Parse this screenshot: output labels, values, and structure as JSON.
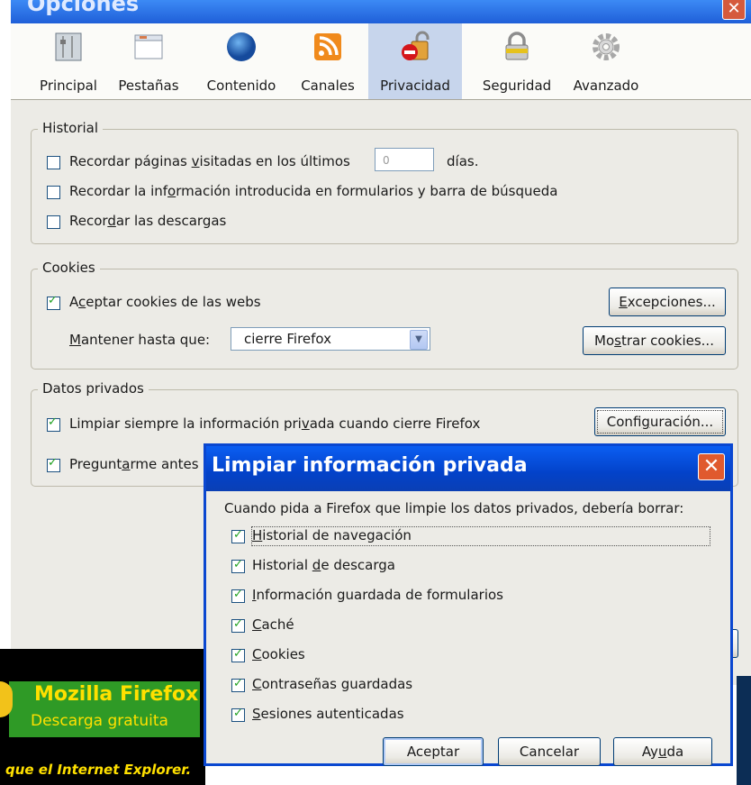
{
  "window": {
    "title": "Opciones"
  },
  "tabs": [
    {
      "label": "Principal",
      "icon": "switch-icon"
    },
    {
      "label": "Pestañas",
      "icon": "tabs-window-icon"
    },
    {
      "label": "Contenido",
      "icon": "globe-icon"
    },
    {
      "label": "Canales",
      "icon": "rss-feed-icon"
    },
    {
      "label": "Privacidad",
      "icon": "privacy-lock-icon",
      "selected": true
    },
    {
      "label": "Seguridad",
      "icon": "padlock-icon"
    },
    {
      "label": "Avanzado",
      "icon": "gear-icon"
    }
  ],
  "history": {
    "legend": "Historial",
    "remember_visited": {
      "label_a": "Recordar páginas ",
      "label_u": "v",
      "label_b": "isitadas en los últimos",
      "days_value": "0",
      "days_unit": "días.",
      "checked": false
    },
    "remember_forms": {
      "label_a": "Recordar la inf",
      "label_u": "o",
      "label_b": "rmación introducida en formularios y barra de búsqueda",
      "checked": false
    },
    "remember_downloads": {
      "label_a": "Recor",
      "label_u": "d",
      "label_b": "ar las descargas",
      "checked": false
    }
  },
  "cookies": {
    "legend": "Cookies",
    "accept": {
      "label_a": "A",
      "label_u": "c",
      "label_b": "eptar cookies de las webs",
      "checked": true
    },
    "keep_until_label_a": "",
    "keep_until_label_u": "M",
    "keep_until_label_b": "antener hasta que:",
    "keep_until_value": "cierre Firefox",
    "exceptions_button_a": "",
    "exceptions_button_u": "E",
    "exceptions_button_b": "xcepciones...",
    "show_cookies_button_a": "Mo",
    "show_cookies_button_u": "s",
    "show_cookies_button_b": "trar cookies..."
  },
  "private_data": {
    "legend": "Datos privados",
    "always_clear": {
      "label_a": "Limpiar siempre la información pri",
      "label_u": "v",
      "label_b": "ada cuando cierre Firefox",
      "checked": true
    },
    "ask_before": {
      "label_a": "Pregunt",
      "label_u": "a",
      "label_b": "rme antes",
      "checked": true
    },
    "settings_button_a": "Confi",
    "settings_button_u": "g",
    "settings_button_b": "uración..."
  },
  "ad": {
    "line1": "Mozilla Firefox",
    "line2": "Descarga gratuita",
    "line3": "que el Internet Explorer."
  },
  "dialog": {
    "title": "Limpiar información privada",
    "intro": "Cuando pida a Firefox que limpie los datos privados, debería borrar:",
    "items": [
      {
        "a": "",
        "u": "H",
        "b": "istorial de navegación",
        "checked": true
      },
      {
        "a": "Historial ",
        "u": "d",
        "b": "e descarga",
        "checked": true
      },
      {
        "a": "",
        "u": "I",
        "b": "nformación guardada de formularios",
        "checked": true
      },
      {
        "a": "",
        "u": "C",
        "b": "aché",
        "checked": true
      },
      {
        "a": "",
        "u": "C",
        "b": "ookies",
        "checked": true
      },
      {
        "a": "",
        "u": "C",
        "b": "ontraseñas guardadas",
        "checked": true
      },
      {
        "a": "",
        "u": "S",
        "b": "esiones autenticadas",
        "checked": true
      }
    ],
    "accept_button": "Aceptar",
    "cancel_button": "Cancelar",
    "help_button_a": "Ay",
    "help_button_u": "u",
    "help_button_b": "da"
  }
}
